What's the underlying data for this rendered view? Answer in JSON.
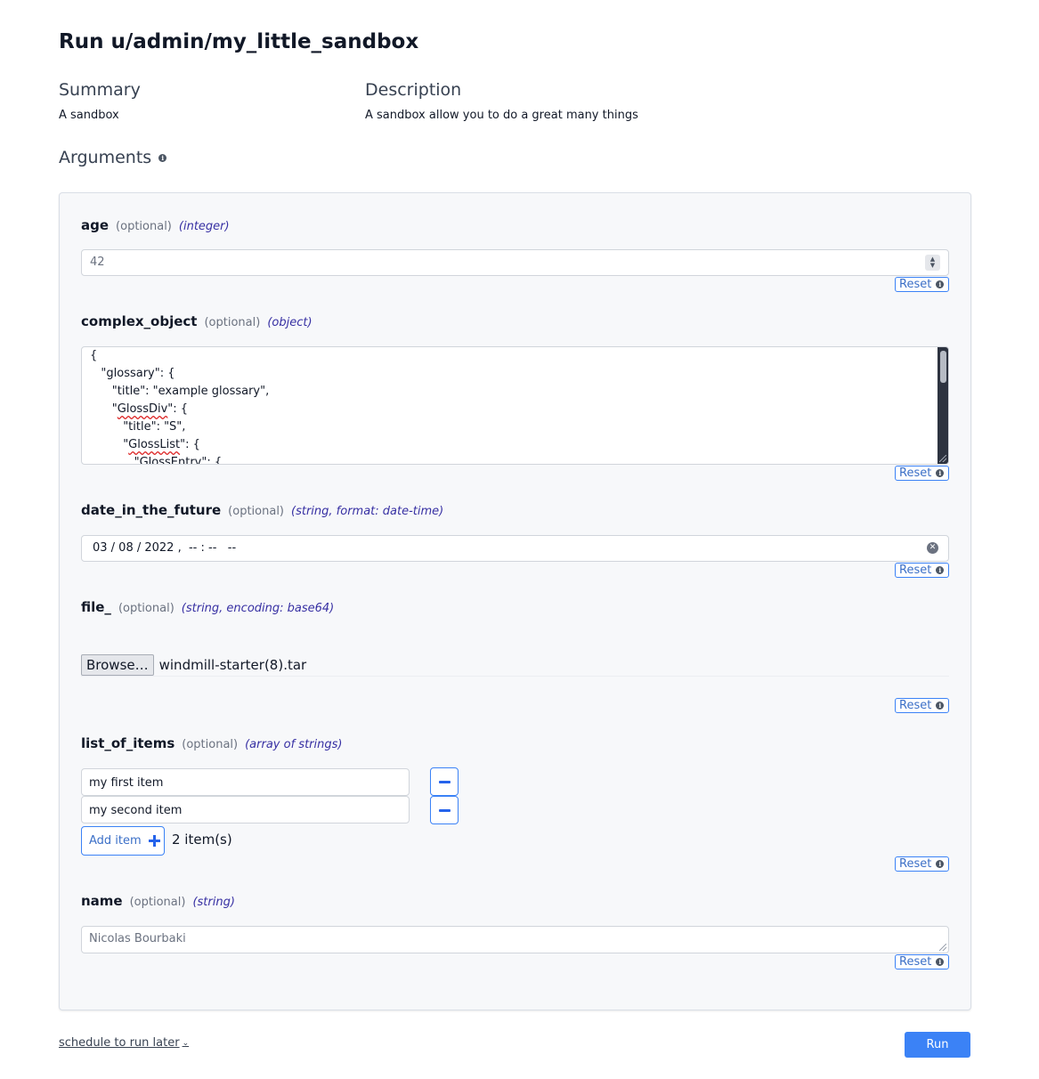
{
  "page": {
    "title": "Run u/admin/my_little_sandbox"
  },
  "summary": {
    "heading": "Summary",
    "value": "A sandbox"
  },
  "description": {
    "heading": "Description",
    "value": "A sandbox allow you to do a great many things"
  },
  "arguments": {
    "heading": "Arguments",
    "info_icon": "info-icon"
  },
  "reset_label": "Reset",
  "fields": {
    "age": {
      "name": "age",
      "optional": "(optional)",
      "type": "(integer)",
      "value": "42"
    },
    "complex_object": {
      "name": "complex_object",
      "optional": "(optional)",
      "type": "(object)",
      "lines": [
        {
          "pre": "{",
          "squig": "",
          "post": ""
        },
        {
          "pre": "   \"glossary\": {",
          "squig": "",
          "post": ""
        },
        {
          "pre": "      \"title\": \"example glossary\",",
          "squig": "",
          "post": ""
        },
        {
          "pre": "      \"",
          "squig": "GlossDiv",
          "post": "\": {"
        },
        {
          "pre": "         \"title\": \"S\",",
          "squig": "",
          "post": ""
        },
        {
          "pre": "         \"",
          "squig": "GlossList",
          "post": "\": {"
        },
        {
          "pre": "            \"",
          "squig": "GlossEntry",
          "post": "\": {"
        }
      ]
    },
    "date_in_the_future": {
      "name": "date_in_the_future",
      "optional": "(optional)",
      "type": "(string, format: date-time)",
      "value": "03 / 08 / 2022 ,  -- : --   --"
    },
    "file_": {
      "name": "file_",
      "optional": "(optional)",
      "type": "(string, encoding: base64)",
      "browse_label": "Browse…",
      "filename": "windmill-starter(8).tar"
    },
    "list_of_items": {
      "name": "list_of_items",
      "optional": "(optional)",
      "type": "(array of strings)",
      "items": [
        "my first item",
        "my second item"
      ],
      "add_label": "Add item",
      "count": "2 item(s)"
    },
    "name": {
      "name": "name",
      "optional": "(optional)",
      "type": "(string)",
      "value": "Nicolas Bourbaki"
    }
  },
  "footer": {
    "schedule_label": "schedule to run later",
    "run_label": "Run"
  }
}
